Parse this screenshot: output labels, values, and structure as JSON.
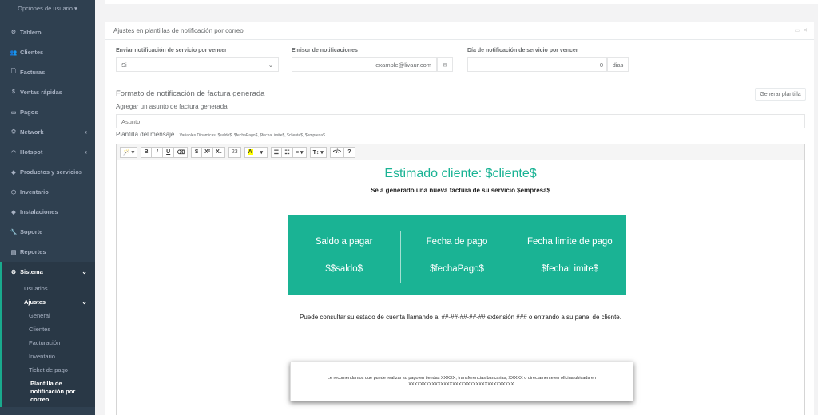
{
  "sidebar": {
    "user_options": "Opciones de usuario",
    "items": [
      {
        "label": "Tablero",
        "icon": "dashboard-icon",
        "glyph": "⏲"
      },
      {
        "label": "Clientes",
        "icon": "users-icon",
        "glyph": "👥"
      },
      {
        "label": "Facturas",
        "icon": "file-icon",
        "glyph": "🗋"
      },
      {
        "label": "Ventas rápidas",
        "icon": "dollar-icon",
        "glyph": "$"
      },
      {
        "label": "Pagos",
        "icon": "money-icon",
        "glyph": "▭"
      },
      {
        "label": "Network",
        "icon": "sitemap-icon",
        "glyph": "⛭",
        "arrow": "‹"
      },
      {
        "label": "Hotspot",
        "icon": "wifi-icon",
        "glyph": "◠",
        "arrow": "‹"
      },
      {
        "label": "Productos y servicios",
        "icon": "tag-icon",
        "glyph": "◆"
      },
      {
        "label": "Inventario",
        "icon": "cubes-icon",
        "glyph": "⬡"
      },
      {
        "label": "Instalaciones",
        "icon": "tags-icon",
        "glyph": "◆"
      },
      {
        "label": "Soporte",
        "icon": "wrench-icon",
        "glyph": "🔧"
      },
      {
        "label": "Reportes",
        "icon": "clipboard-icon",
        "glyph": "▤"
      }
    ],
    "sistema": {
      "label": "Sistema",
      "icon": "cogs-icon",
      "glyph": "⚙",
      "arrow": "⌄"
    },
    "usuarios": "Usuarios",
    "ajustes": "Ajustes",
    "ajustes_arrow": "⌄",
    "ajustes_sub": [
      "General",
      "Clientes",
      "Facturación",
      "Inventario",
      "Ticket de pago"
    ],
    "active_sub": "Plantilla de notificación por correo"
  },
  "panel": {
    "title": "Ajustes en plantillas de notificación por correo",
    "tools": [
      "▭",
      "✕"
    ]
  },
  "form": {
    "enviar_label": "Enviar notificación de servicio por vencer",
    "enviar_value": "Si",
    "emisor_label": "Emisor de notificaciones",
    "emisor_value": "example@livaur.com",
    "dia_label": "Día de notificación de servicio por vencer",
    "dia_value": "0",
    "dia_unit": "dias"
  },
  "template": {
    "section_title": "Formato de notificación de factura generada",
    "generate_button": "Generar plantilla",
    "subject_label": "Agregar un asunto de factura generada",
    "subject_placeholder": "Asunto",
    "message_label": "Plantilla del mensaje",
    "variables": "Variables Dinamicas: $saldo$, $fechaPago$, $fechaLimite$, $cliente$, $empresa$"
  },
  "toolbar": {
    "font_size": "23",
    "bold": "B",
    "italic": "I",
    "underline": "U",
    "eraser": "⌫",
    "strike": "S",
    "superscript": "X²",
    "subscript": "X₂",
    "color": "A",
    "help": "?",
    "code": "</>"
  },
  "content": {
    "greeting": "Estimado cliente: $cliente$",
    "subgreeting": "Se a generado una nueva factura de su servicio $empresa$",
    "box": [
      {
        "label": "Saldo a pagar",
        "value": "$$saldo$"
      },
      {
        "label": "Fecha de pago",
        "value": "$fechaPago$"
      },
      {
        "label": "Fecha limite de pago",
        "value": "$fechaLimite$"
      }
    ],
    "consult": "Puede consultar su estado de cuenta llamando al ##-##-##-##-## extensión ### o entrando a su panel de cliente.",
    "note": "Le recomendamos que puede realizar su pago en tiendas XXXXX, transferencias bancarias, XXXXX o directamente en oficina ubicada en XXXXXXXXXXXXXXXXXXXXXXXXXXXXXXXXXXXX."
  },
  "colors": {
    "sidebar": "#2f4050",
    "accent": "#1ab394"
  }
}
